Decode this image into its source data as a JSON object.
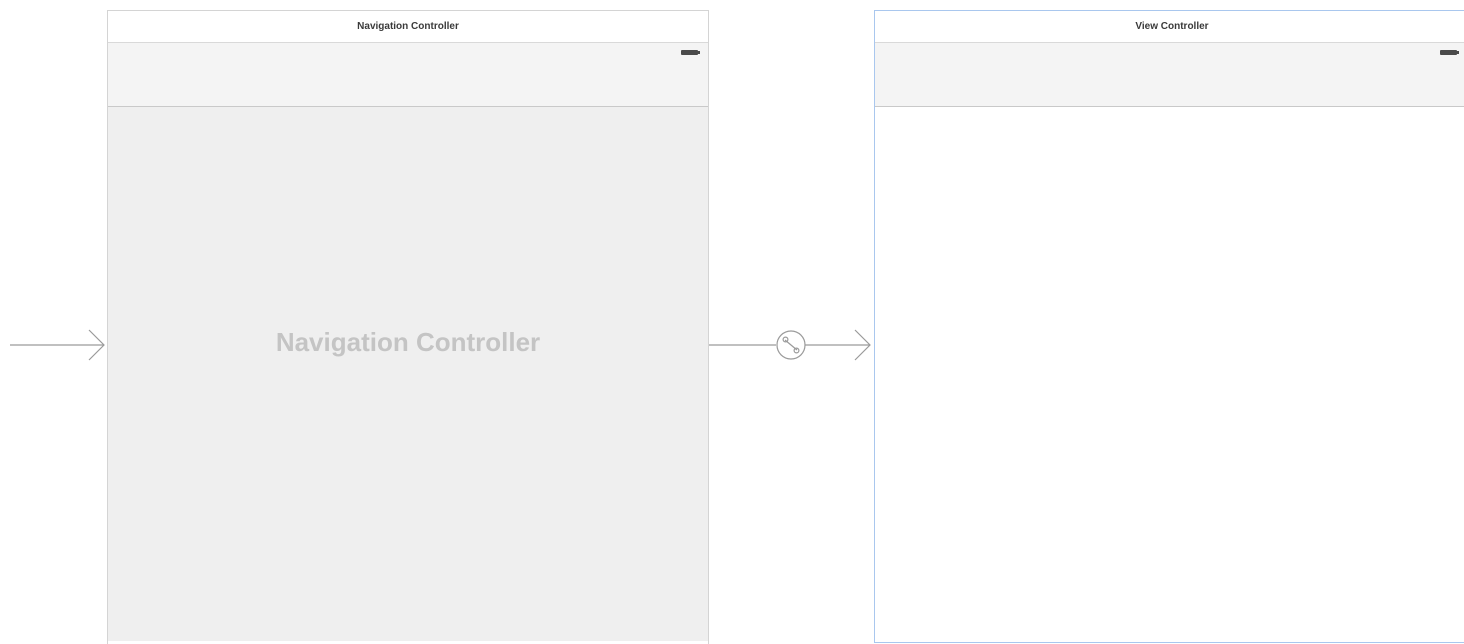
{
  "navigation_controller": {
    "title": "Navigation Controller",
    "placeholder_label": "Navigation Controller"
  },
  "view_controller": {
    "title": "View Controller"
  },
  "colors": {
    "selection_border": "#a9c7ee",
    "placeholder_text": "#c4c4c4",
    "connector": "#9a9a9a"
  }
}
